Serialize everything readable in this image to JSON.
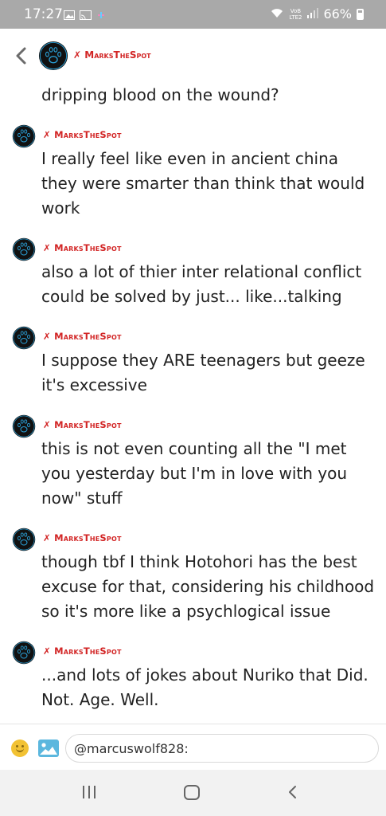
{
  "status_bar": {
    "time": "17:27",
    "network_label": "VoB LTE2",
    "battery": "66%"
  },
  "header": {
    "username": "MarksTheSpot",
    "x_mark": "✗"
  },
  "partial_message": {
    "text": "dripping blood on the wound?"
  },
  "messages": [
    {
      "author": "MarksTheSpot",
      "text": "I really feel like even in ancient china they were smarter than think that would work"
    },
    {
      "author": "MarksTheSpot",
      "text": "also a lot of thier inter relational conflict could be solved by just... like...talking"
    },
    {
      "author": "MarksTheSpot",
      "text": "I suppose they ARE teenagers but geeze it's excessive"
    },
    {
      "author": "MarksTheSpot",
      "text": "this is not even counting all the \"I met you yesterday but I'm in love with you now\" stuff"
    },
    {
      "author": "MarksTheSpot",
      "text": "though tbf I think Hotohori has the best excuse for that, considering his childhood so it's more like a psychlogical issue"
    },
    {
      "author": "MarksTheSpot",
      "text": "...and lots of jokes about Nuriko that Did. Not. Age. Well."
    }
  ],
  "composer": {
    "value": "@marcuswolf828:"
  },
  "colors": {
    "accent_red": "#d22525",
    "avatar_bg": "#111111",
    "avatar_ring": "#2a9fd6"
  }
}
